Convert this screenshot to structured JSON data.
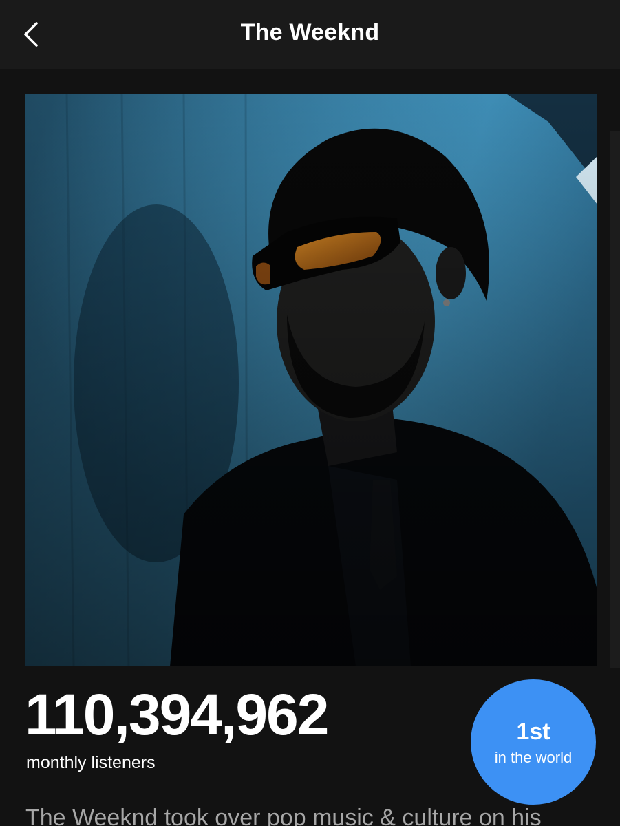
{
  "header": {
    "title": "The Weeknd",
    "back_icon": "chevron-left-icon"
  },
  "artist_image": {
    "description_icon": "artist-photo"
  },
  "stats": {
    "monthly_listeners": "110,394,962",
    "monthly_listeners_label": "monthly listeners",
    "rank_value": "1st",
    "rank_label": "in the world"
  },
  "bio": {
    "text": "The Weeknd took over pop music & culture on his"
  },
  "colors": {
    "background": "#121212",
    "header": "#1a1a1a",
    "badge": "#3d91f4",
    "bio_text": "#a7a7a7"
  }
}
